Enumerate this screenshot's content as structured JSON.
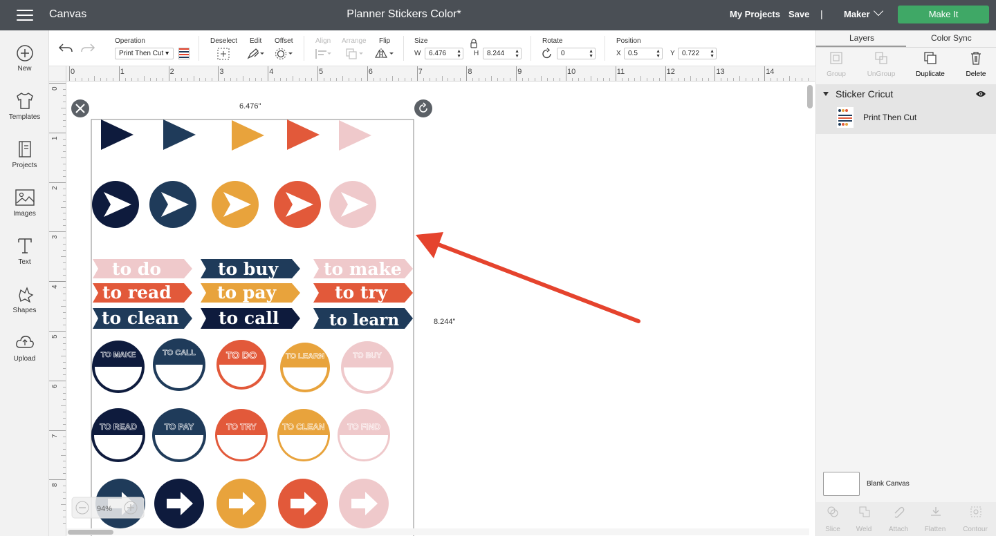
{
  "topbar": {
    "app_name": "Canvas",
    "document_title": "Planner Stickers Color*",
    "my_projects": "My Projects",
    "save": "Save",
    "separator": "|",
    "machine": "Maker",
    "make_it": "Make It"
  },
  "leftnav": {
    "items": [
      {
        "label": "New",
        "icon": "plus-circle-icon"
      },
      {
        "label": "Templates",
        "icon": "tshirt-icon"
      },
      {
        "label": "Projects",
        "icon": "notebook-icon"
      },
      {
        "label": "Images",
        "icon": "image-icon"
      },
      {
        "label": "Text",
        "icon": "text-T-icon"
      },
      {
        "label": "Shapes",
        "icon": "shapes-icon"
      },
      {
        "label": "Upload",
        "icon": "cloud-upload-icon"
      }
    ]
  },
  "toolbar": {
    "operation_label": "Operation",
    "operation_value": "Print Then Cut",
    "deselect": "Deselect",
    "edit": "Edit",
    "offset": "Offset",
    "align": "Align",
    "arrange": "Arrange",
    "flip": "Flip",
    "size_label": "Size",
    "w_label": "W",
    "w_value": "6.476",
    "h_label": "H",
    "h_value": "8.244",
    "rotate_label": "Rotate",
    "rotate_value": "0",
    "position_label": "Position",
    "x_label": "X",
    "x_value": "0.5",
    "y_label": "Y",
    "y_value": "0.722"
  },
  "rulers": {
    "top": [
      "0",
      "1",
      "2",
      "3",
      "4",
      "5",
      "6",
      "7",
      "8",
      "9",
      "10",
      "11",
      "12",
      "13",
      "14"
    ],
    "left": [
      "0",
      "1",
      "2",
      "3",
      "4",
      "5",
      "6",
      "7",
      "8"
    ]
  },
  "canvas": {
    "width_label": "6.476\"",
    "height_label": "8.244\"",
    "zoom": "94%",
    "word_stickers": [
      "to do",
      "to buy",
      "to make",
      "to read",
      "to pay",
      "to try",
      "to clean",
      "to call",
      "to learn"
    ],
    "badge_row_1": [
      "TO MAKE",
      "TO CALL",
      "TO DO",
      "TO LEARN",
      "TO BUY"
    ],
    "badge_row_2": [
      "TO READ",
      "TO PAY",
      "TO TRY",
      "TO CLEAN",
      "TO FIND"
    ],
    "colors": {
      "navy": "#0e1b3d",
      "slate": "#1f3b5a",
      "mustard": "#e8a33c",
      "coral": "#e2593a",
      "blush": "#efc9cb",
      "arrow": "#e5432d"
    }
  },
  "rightpanel": {
    "tab_layers": "Layers",
    "tab_color_sync": "Color Sync",
    "group": "Group",
    "ungroup": "UnGroup",
    "duplicate": "Duplicate",
    "delete": "Delete",
    "layer_group_name": "Sticker Cricut",
    "layer_item": "Print Then Cut",
    "blank_canvas": "Blank Canvas",
    "bottom_tools": [
      "Slice",
      "Weld",
      "Attach",
      "Flatten",
      "Contour"
    ]
  }
}
